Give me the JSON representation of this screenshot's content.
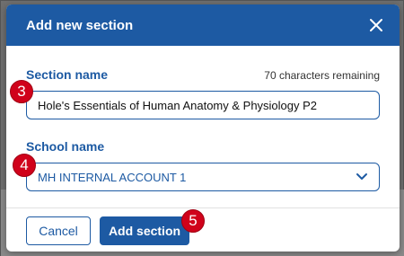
{
  "dialog": {
    "title": "Add new section",
    "close_icon": "close-icon"
  },
  "section_name": {
    "label": "Section name",
    "chars_remaining": "70 characters remaining",
    "value": "Hole's Essentials of Human Anatomy & Physiology P2"
  },
  "school_name": {
    "label": "School name",
    "selected": "MH INTERNAL ACCOUNT 1",
    "chevron_icon": "chevron-down-icon"
  },
  "footer": {
    "cancel_label": "Cancel",
    "add_label": "Add section"
  },
  "badges": {
    "step3": "3",
    "step4": "4",
    "step5": "5"
  },
  "colors": {
    "primary": "#1d5aa3",
    "badge": "#d0021b"
  }
}
